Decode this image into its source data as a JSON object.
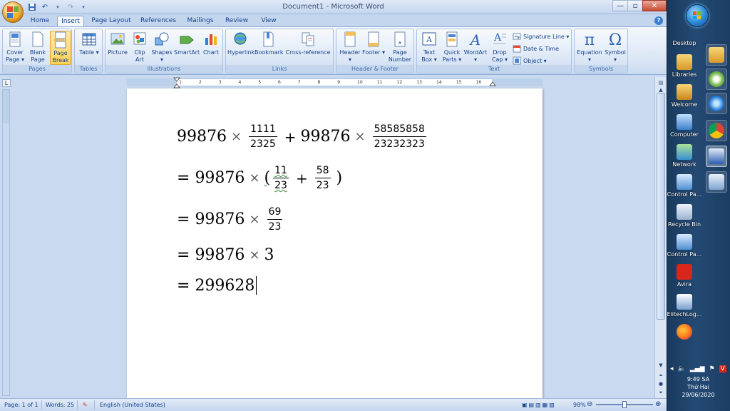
{
  "window": {
    "title": "Document1 - Microsoft Word",
    "minimize": "—",
    "maximize": "▫",
    "close": "✕"
  },
  "tabs": [
    {
      "label": "Home",
      "active": false
    },
    {
      "label": "Insert",
      "active": true
    },
    {
      "label": "Page Layout",
      "active": false
    },
    {
      "label": "References",
      "active": false
    },
    {
      "label": "Mailings",
      "active": false
    },
    {
      "label": "Review",
      "active": false
    },
    {
      "label": "View",
      "active": false
    }
  ],
  "ribbon": {
    "pages": {
      "label": "Pages",
      "cover_page": "Cover Page ▾",
      "blank_page": "Blank Page",
      "page_break": "Page Break"
    },
    "tables": {
      "label": "Tables",
      "table": "Table ▾"
    },
    "illustrations": {
      "label": "Illustrations",
      "picture": "Picture",
      "clip_art": "Clip Art",
      "shapes": "Shapes ▾",
      "smartart": "SmartArt",
      "chart": "Chart"
    },
    "links": {
      "label": "Links",
      "hyperlink": "Hyperlink",
      "bookmark": "Bookmark",
      "cross_reference": "Cross-reference"
    },
    "header_footer": {
      "label": "Header & Footer",
      "header": "Header ▾",
      "footer": "Footer ▾",
      "page_number": "Page Number ▾"
    },
    "text": {
      "label": "Text",
      "text_box": "Text Box ▾",
      "quick_parts": "Quick Parts ▾",
      "wordart": "WordArt ▾",
      "drop_cap": "Drop Cap ▾",
      "signature_line": "Signature Line ▾",
      "date_time": "Date & Time",
      "object": "Object ▾"
    },
    "symbols": {
      "label": "Symbols",
      "equation": "Equation ▾",
      "symbol": "Symbol ▾"
    }
  },
  "document": {
    "line1": {
      "a": "99876",
      "times": "×",
      "f1_num": "1111",
      "f1_den": "2325",
      "plus": "+",
      "b": "99876",
      "times2": "×",
      "f2_num": "58585858",
      "f2_den": "23232323"
    },
    "line2": {
      "eq": "=",
      "a": "99876",
      "times": "×",
      "open": "(",
      "f1_num": "11",
      "f1_den": "23",
      "plus": "+",
      "f2_num": "58",
      "f2_den": "23",
      "close": ")"
    },
    "line3": {
      "eq": "=",
      "a": "99876",
      "times": "×",
      "f_num": "69",
      "f_den": "23"
    },
    "line4": {
      "eq": "=",
      "a": "99876",
      "times": "×",
      "b": "3"
    },
    "line5": {
      "eq": "=",
      "result": "299628"
    }
  },
  "ruler_numbers": [
    "2",
    "1",
    "1",
    "2",
    "3",
    "4",
    "5",
    "6",
    "7",
    "8",
    "9",
    "10",
    "11",
    "12",
    "13",
    "14",
    "15",
    "16",
    "17",
    "18"
  ],
  "statusbar": {
    "page": "Page: 1 of 1",
    "words": "Words: 25",
    "language": "English (United States)",
    "zoom": "98%"
  },
  "desktop": {
    "label": "Desktop",
    "icons": [
      "Libraries",
      "Welcome",
      "Computer",
      "Network",
      "Control Pa...",
      "Recycle Bin",
      "Control Pa...",
      "Avira",
      "ElitechLog..."
    ]
  },
  "clock": {
    "time": "9:49 SA",
    "day": "Thứ Hai",
    "date": "29/06/2020"
  },
  "colors": {
    "accent": "#15428b",
    "ribbon_bg": "#dae6f5",
    "taskbar": "#244a74"
  }
}
